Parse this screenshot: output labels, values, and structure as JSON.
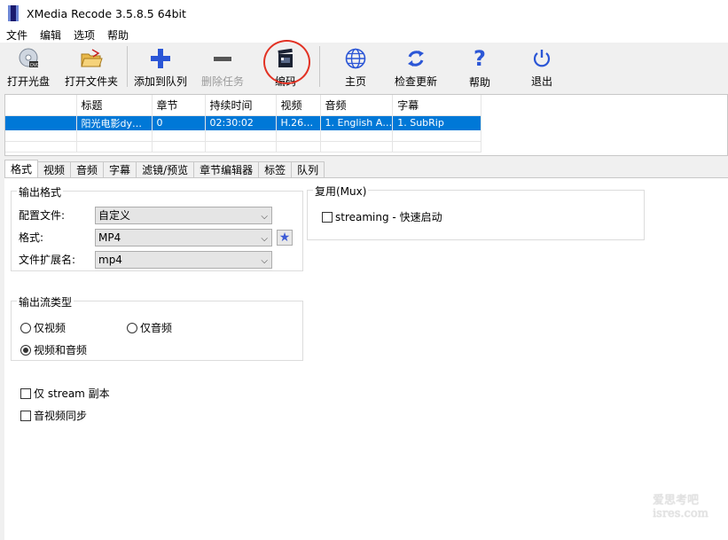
{
  "window": {
    "title": "XMedia Recode 3.5.8.5 64bit"
  },
  "menu": [
    "文件",
    "编辑",
    "选项",
    "帮助"
  ],
  "toolbar": {
    "open_disc": "打开光盘",
    "open_folder": "打开文件夹",
    "add_queue": "添加到队列",
    "delete_task": "删除任务",
    "encode": "编码",
    "home": "主页",
    "check_update": "检查更新",
    "help": "帮助",
    "exit": "退出"
  },
  "file_list": {
    "columns": [
      "",
      "标题",
      "章节",
      "持续时间",
      "视频",
      "音频",
      "字幕"
    ],
    "rows": [
      {
        "cells": [
          "",
          "阳光电影dy…",
          "0",
          "02:30:02",
          "H.26…",
          "1. English A…",
          "1. SubRip"
        ]
      }
    ]
  },
  "tabs": [
    "格式",
    "视频",
    "音频",
    "字幕",
    "滤镜/预览",
    "章节编辑器",
    "标签",
    "队列"
  ],
  "output_format": {
    "title": "输出格式",
    "profile_label": "配置文件:",
    "profile_value": "自定义",
    "format_label": "格式:",
    "format_value": "MP4",
    "extension_label": "文件扩展名:",
    "extension_value": "mp4"
  },
  "mux": {
    "title": "复用(Mux)",
    "streaming_label": "streaming - 快速启动",
    "streaming_checked": false
  },
  "stream_type": {
    "title": "输出流类型",
    "video_only": "仅视频",
    "audio_only": "仅音频",
    "video_audio": "视频和音频",
    "selected": "video_audio"
  },
  "options": {
    "stream_copy_only": "仅 stream 副本",
    "av_sync": "音视频同步"
  },
  "colors": {
    "selection": "#0078d7",
    "accent_blue": "#2b56d6",
    "highlight_circle": "#e23224"
  },
  "watermark": {
    "line1": "爱思考吧",
    "line2": "isres.com"
  }
}
